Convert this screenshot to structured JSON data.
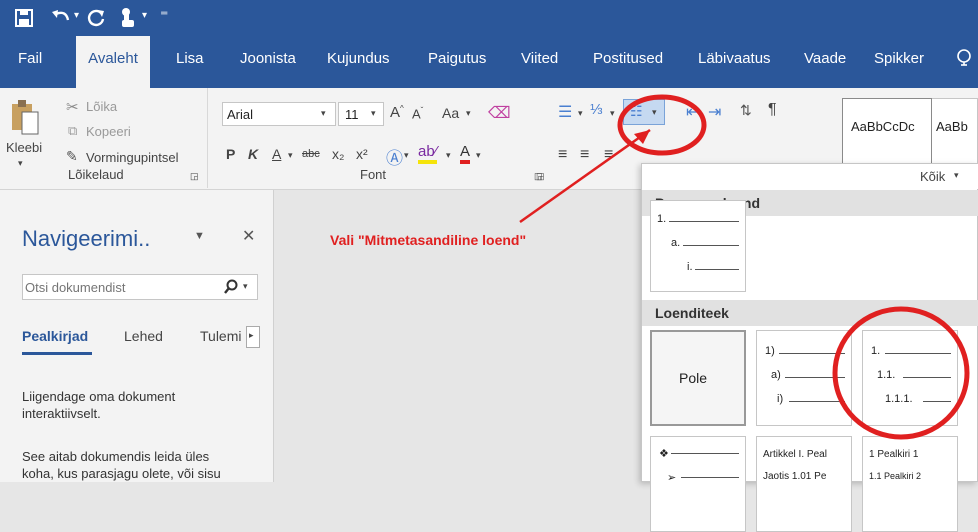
{
  "qat": {
    "save_icon": "save-icon",
    "undo_icon": "undo-icon",
    "redo_icon": "redo-icon",
    "touch_icon": "touch-mode-icon",
    "customize_icon": "customize-qat-icon"
  },
  "tabs": [
    "Fail",
    "Avaleht",
    "Lisa",
    "Joonista",
    "Kujundus",
    "Paigutus",
    "Viited",
    "Postitused",
    "Läbivaatus",
    "Vaade",
    "Spikker"
  ],
  "ribbon": {
    "clipboard": {
      "paste": "Kleebi",
      "cut": "Lõika",
      "copy": "Kopeeri",
      "format_painter": "Vormingupintsel",
      "label": "Lõikelaud"
    },
    "font": {
      "name": "Arial",
      "size": "11",
      "bold": "P",
      "italic": "K",
      "underline": "A",
      "strike": "abc",
      "sub": "x₂",
      "sup": "x²",
      "label": "Font",
      "case": "Aa"
    },
    "styles": {
      "sample1": "AaBbCcDc",
      "sample2": "AaBb",
      "all": "Kõik"
    }
  },
  "nav": {
    "title": "Navigeerimi..",
    "search_placeholder": "Otsi dokumendist",
    "tabs": [
      "Pealkirjad",
      "Lehed",
      "Tulemi"
    ],
    "text1": "Liigendage oma dokument interaktiivselt.",
    "text2a": "See aitab dokumendis leida üles",
    "text2b": "koha, kus parasjagu olete, või sisu"
  },
  "annotation": {
    "text": "Vali \"Mitmetasandiline loend\"",
    "color": "#e02020"
  },
  "gallery": {
    "current_header": "Praegune loend",
    "library_header": "Loenditeek",
    "none_label": "Pole",
    "current": [
      "1.",
      "a.",
      "i."
    ],
    "list2": [
      "1)",
      "a)",
      "i)"
    ],
    "list3": [
      "1.",
      "1.1.",
      "1.1.1."
    ],
    "list4": [
      "Artikkel I. Peal",
      "Jaotis 1.01 Pe"
    ],
    "list5": [
      "1 Pealkiri 1",
      "1.1 Pealkiri 2"
    ]
  }
}
